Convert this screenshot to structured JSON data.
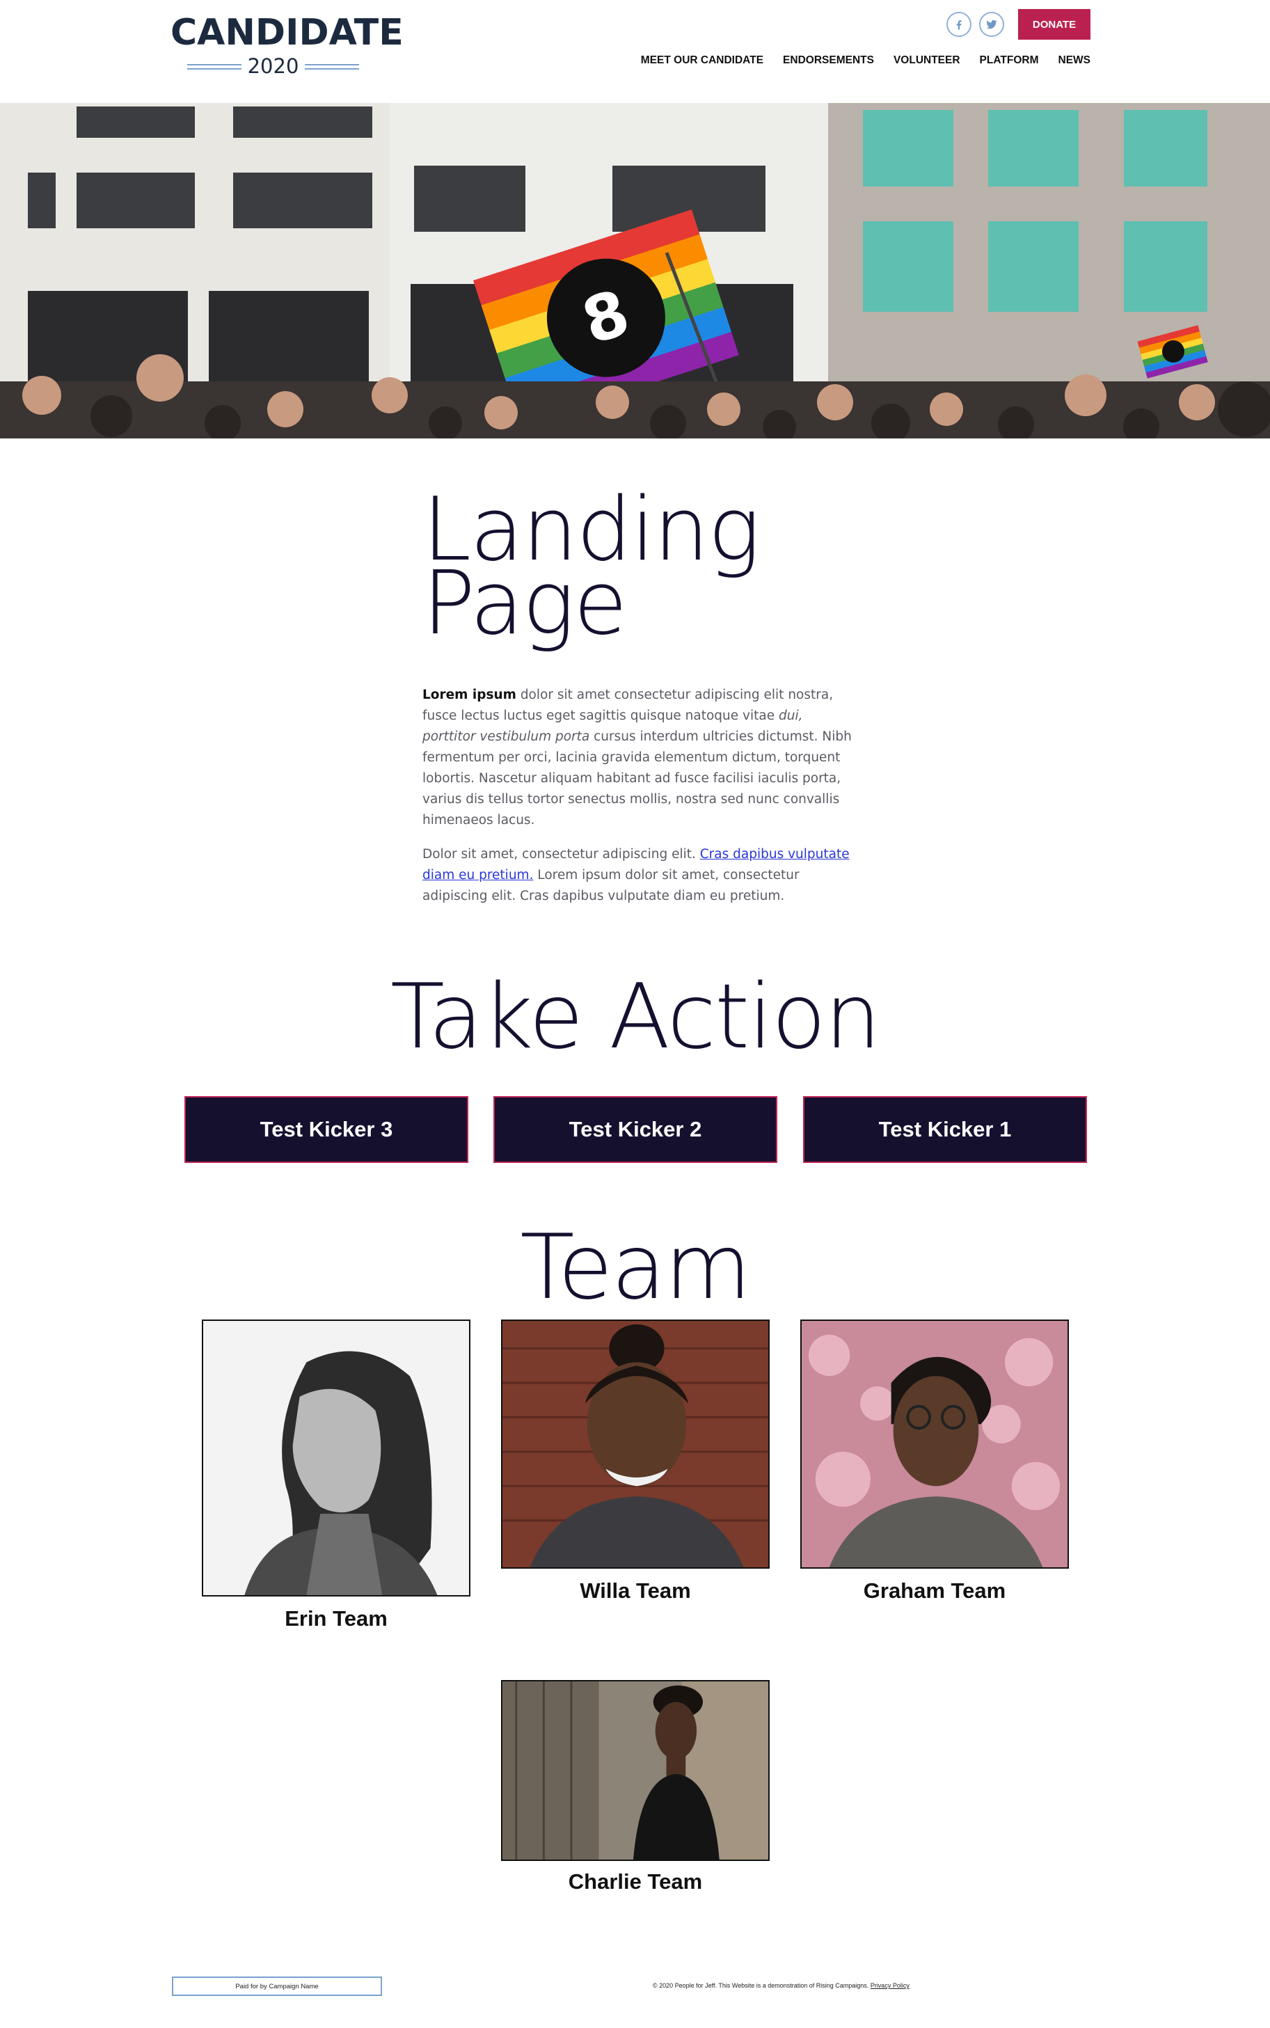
{
  "header": {
    "logo_main": "CANDIDATE",
    "logo_year": "2020",
    "donate_label": "DONATE",
    "social": [
      "facebook-icon",
      "twitter-icon"
    ],
    "nav": [
      "MEET OUR CANDIDATE",
      "ENDORSEMENTS",
      "VOLUNTEER",
      "PLATFORM",
      "NEWS"
    ]
  },
  "intro": {
    "title_line1": "Landing",
    "title_line2": "Page",
    "p1_bold": "Lorem ipsum",
    "p1_a": " dolor sit amet consectetur adipiscing elit nostra, fusce lectus luctus eget sagittis quisque natoque vitae ",
    "p1_italic": "dui, porttitor vestibulum porta",
    "p1_b": " cursus interdum ultricies dictumst. Nibh fermentum per orci, lacinia gravida elementum dictum, torquent lobortis. Nascetur aliquam habitant ad fusce facilisi iaculis porta, varius dis tellus tortor senectus mollis, nostra sed nunc convallis himenaeos lacus.",
    "p2_a": "Dolor sit amet, consectetur adipiscing elit. ",
    "p2_link": "Cras dapibus vulputate diam eu pretium.",
    "p2_b": " Lorem ipsum dolor sit amet, consectetur adipiscing elit. Cras dapibus vulputate diam eu pretium."
  },
  "take_action": {
    "title": "Take Action",
    "kickers": [
      "Test Kicker 3",
      "Test Kicker 2",
      "Test Kicker 1"
    ]
  },
  "team": {
    "title": "Team",
    "members": [
      {
        "name": "Erin Team"
      },
      {
        "name": "Willa Team"
      },
      {
        "name": "Graham Team"
      },
      {
        "name": "Charlie Team"
      }
    ]
  },
  "footer": {
    "paid_for": "Paid for by Campaign Name",
    "copyright": "© 2020 People for Jeff. This Website is a demonstration of Rising Campaigns.",
    "privacy_link": "Privacy Policy"
  },
  "colors": {
    "accent": "#bb2150",
    "navy": "#16102f",
    "logo_blue": "#7aa2cf"
  }
}
